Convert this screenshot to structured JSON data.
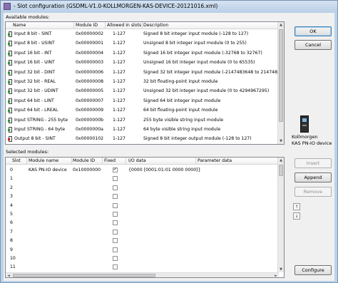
{
  "window": {
    "title": "- Slot configuration (GSDML-V1.0-KOLLMORGEN-KAS-DEVICE-20121016.xml)"
  },
  "available": {
    "label": "Available modules:",
    "columns": [
      "Name",
      "Module ID",
      "Allowed in slots",
      "Description"
    ],
    "rows": [
      {
        "name": "Input  8 bit - SINT",
        "id": "0x00000002",
        "slots": "1-127",
        "desc": "Signed 8 bit integer input module (-128 to 127)",
        "dir": "in"
      },
      {
        "name": "Input  8 bit - USINT",
        "id": "0x00000001",
        "slots": "1-127",
        "desc": "Unsigned 8 bit integer input module (0 to 255)",
        "dir": "in"
      },
      {
        "name": "Input  16 bit - INT",
        "id": "0x00000004",
        "slots": "1-127",
        "desc": "Signed 16 bit integer input module (-32768 to 32767)",
        "dir": "in"
      },
      {
        "name": "Input  16 bit - UINT",
        "id": "0x00000003",
        "slots": "1-127",
        "desc": "Unsigned 16 bit integer input module (0 to 65535)",
        "dir": "in"
      },
      {
        "name": "Input  32 bit - DINT",
        "id": "0x00000006",
        "slots": "1-127",
        "desc": "Signed 32 bit integer input module (-2147483648 to 2147483647)",
        "dir": "in"
      },
      {
        "name": "Input  32 bit - REAL",
        "id": "0x00000008",
        "slots": "1-127",
        "desc": "32 bit floating-point input module",
        "dir": "in"
      },
      {
        "name": "Input  32 bit - UDINT",
        "id": "0x00000005",
        "slots": "1-127",
        "desc": "Unsigned 32 bit integer input module (0 to 4294967295)",
        "dir": "in"
      },
      {
        "name": "Input  64 bit - LINT",
        "id": "0x00000007",
        "slots": "1-127",
        "desc": "Signed 64 bit integer input module",
        "dir": "in"
      },
      {
        "name": "Input  64 bit - LREAL",
        "id": "0x00000009",
        "slots": "1-127",
        "desc": "64 bit floating-point input module",
        "dir": "in"
      },
      {
        "name": "Input  STRING - 255 byte",
        "id": "0x0000000b",
        "slots": "1-127",
        "desc": "255 byte visible string input module",
        "dir": "in"
      },
      {
        "name": "Input  STRING - 64 byte",
        "id": "0x0000000a",
        "slots": "1-127",
        "desc": "64 byte visible string input module",
        "dir": "in"
      },
      {
        "name": "Output  8 bit - SINT",
        "id": "0x00000102",
        "slots": "1-127",
        "desc": "Signed 8 bit integer output module (-128 to 127)",
        "dir": "out"
      }
    ]
  },
  "buttons": {
    "ok": "OK",
    "cancel": "Cancel",
    "insert": "Insert",
    "append": "Append",
    "remove": "Remove",
    "configure": "Configure"
  },
  "device": {
    "line1": "Kollmorgen",
    "line2": "KAS PN-IO device"
  },
  "selected": {
    "label": "Selected modules:",
    "columns": [
      "Slot",
      "Module name",
      "Module ID",
      "Fixed",
      "I/O data",
      "Parameter data"
    ],
    "rows": [
      {
        "slot": "0",
        "name": "KAS PN-IO device",
        "id": "0x10000000",
        "fixed": true,
        "io": "{0000 [0001:01:01 0000 0000]}",
        "param": ""
      },
      {
        "slot": "1",
        "name": "",
        "id": "",
        "fixed": false,
        "io": "",
        "param": ""
      },
      {
        "slot": "2",
        "name": "",
        "id": "",
        "fixed": false,
        "io": "",
        "param": ""
      },
      {
        "slot": "3",
        "name": "",
        "id": "",
        "fixed": false,
        "io": "",
        "param": ""
      },
      {
        "slot": "4",
        "name": "",
        "id": "",
        "fixed": false,
        "io": "",
        "param": ""
      },
      {
        "slot": "5",
        "name": "",
        "id": "",
        "fixed": false,
        "io": "",
        "param": ""
      },
      {
        "slot": "6",
        "name": "",
        "id": "",
        "fixed": false,
        "io": "",
        "param": ""
      },
      {
        "slot": "7",
        "name": "",
        "id": "",
        "fixed": false,
        "io": "",
        "param": ""
      },
      {
        "slot": "8",
        "name": "",
        "id": "",
        "fixed": false,
        "io": "",
        "param": ""
      },
      {
        "slot": "9",
        "name": "",
        "id": "",
        "fixed": false,
        "io": "",
        "param": ""
      },
      {
        "slot": "10",
        "name": "",
        "id": "",
        "fixed": false,
        "io": "",
        "param": ""
      },
      {
        "slot": "11",
        "name": "",
        "id": "",
        "fixed": false,
        "io": "",
        "param": ""
      }
    ]
  },
  "icons": {
    "move_up": "move-up-icon",
    "move_down": "move-down-icon",
    "input_module": "input-module-icon",
    "output_module": "output-module-icon",
    "device": "device-icon"
  },
  "colors": {
    "input_accent": "#1e9d2e",
    "output_accent": "#d02020",
    "focus_border": "#3c7fb1"
  }
}
